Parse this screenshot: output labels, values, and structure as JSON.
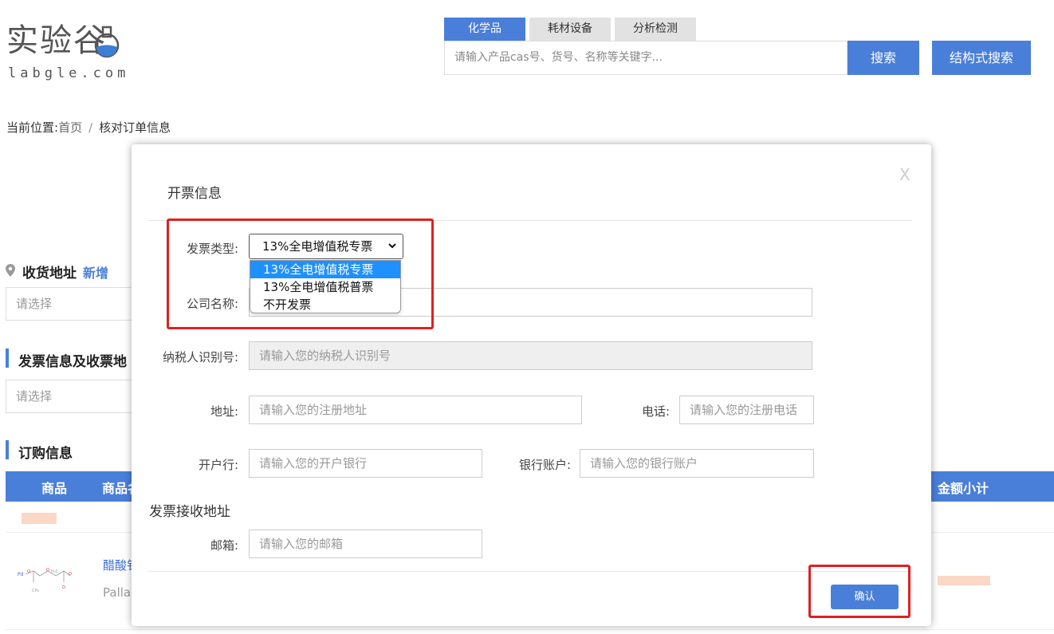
{
  "header": {
    "logo_cn": "实验谷",
    "logo_en": "labgle.com",
    "tabs": [
      {
        "label": "化学品",
        "active": true
      },
      {
        "label": "耗材设备",
        "active": false
      },
      {
        "label": "分析检测",
        "active": false
      }
    ],
    "search_placeholder": "请输入产品cas号、货号、名称等关键字...",
    "search_label": "搜索",
    "structure_search_label": "结构式搜索"
  },
  "breadcrumb": {
    "prefix": "当前位置:",
    "home": "首页",
    "separator": "/",
    "current": "核对订单信息"
  },
  "page": {
    "shipping_title": "收货地址",
    "shipping_new": "新增",
    "shipping_placeholder": "请选择",
    "invoice_section_title": "发票信息及收票地",
    "invoice_placeholder": "请选择",
    "order_title": "订购信息",
    "table_headers": [
      "商品",
      "商品名",
      "金额小计"
    ],
    "product_name": "醋酸钅",
    "product_sub": "Palla"
  },
  "modal": {
    "close_label": "X",
    "title": "开票信息",
    "invoice_type_label": "发票类型:",
    "invoice_type_value": "13%全电增值税专票",
    "invoice_type_options": [
      "13%全电增值税专票",
      "13%全电增值税普票",
      "不开发票"
    ],
    "company_label": "公司名称:",
    "taxpayer_label": "纳税人识别号:",
    "taxpayer_placeholder": "请输入您的纳税人识别号",
    "address_label": "地址:",
    "address_placeholder": "请输入您的注册地址",
    "phone_label": "电话:",
    "phone_placeholder": "请输入您的注册电话",
    "bank_label": "开户行:",
    "bank_placeholder": "请输入您的开户银行",
    "account_label": "银行账户:",
    "account_placeholder": "请输入您的银行账户",
    "receive_title": "发票接收地址",
    "email_label": "邮箱:",
    "email_placeholder": "请输入您的邮箱",
    "confirm_label": "确认"
  },
  "colors": {
    "accent": "#4a7fd9",
    "highlight": "#e02020",
    "option_selected": "#1e90ff"
  }
}
